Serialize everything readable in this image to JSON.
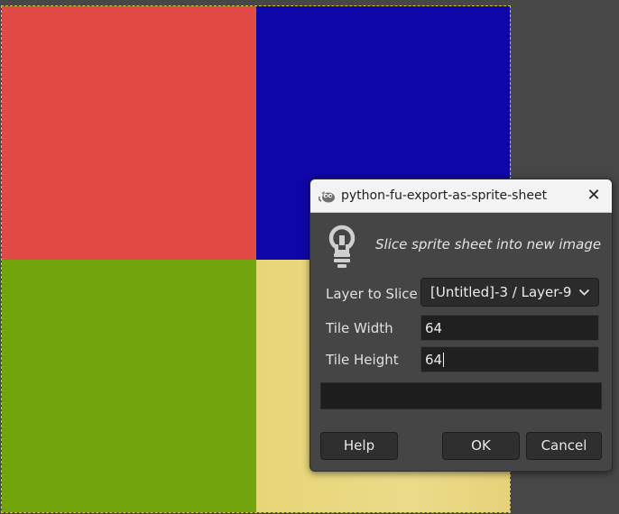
{
  "canvas": {
    "colors": {
      "top_left": "#e24a46",
      "top_right": "#0e06a6",
      "bottom_left": "#72a40b",
      "bottom_right": "#ead77c"
    }
  },
  "dialog": {
    "title": "python-fu-export-as-sprite-sheet",
    "close_label": "✕",
    "hint": "Slice sprite sheet into new image",
    "fields": {
      "layer": {
        "label": "Layer to Slice",
        "value": "[Untitled]-3 / Layer-9"
      },
      "tile_width": {
        "label": "Tile Width",
        "value": "64"
      },
      "tile_height": {
        "label": "Tile Height",
        "value": "64"
      }
    },
    "progress": 0,
    "buttons": {
      "help": "Help",
      "ok": "OK",
      "cancel": "Cancel"
    }
  }
}
